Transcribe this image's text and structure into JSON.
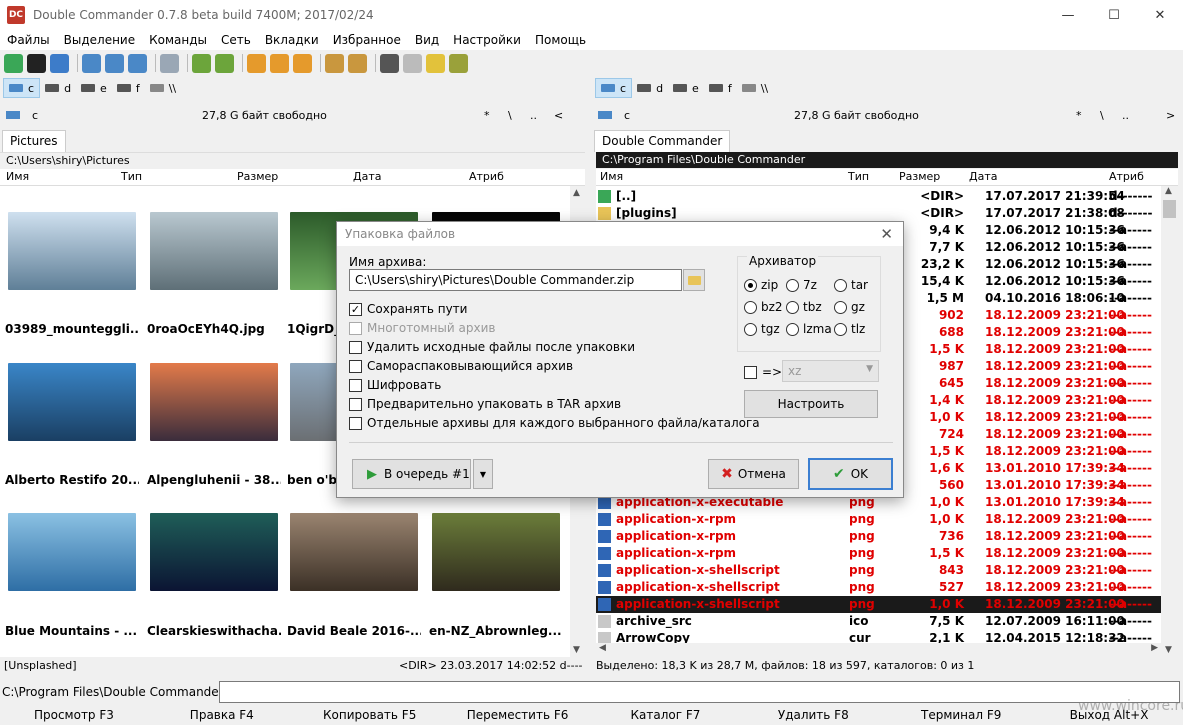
{
  "window": {
    "title": "Double Commander 0.7.8 beta build 7400M; 2017/02/24",
    "app_icon": "DC"
  },
  "menu": [
    "Файлы",
    "Выделение",
    "Команды",
    "Сеть",
    "Вкладки",
    "Избранное",
    "Вид",
    "Настройки",
    "Помощь"
  ],
  "drives": [
    {
      "label": "c"
    },
    {
      "label": "d"
    },
    {
      "label": "e"
    },
    {
      "label": "f"
    },
    {
      "label": "\\\\"
    }
  ],
  "left": {
    "drive": "c",
    "free": "27,8 G байт свободно",
    "nav": [
      "*",
      "\\",
      "..",
      "<"
    ],
    "tab": "Pictures",
    "path": "C:\\Users\\shiry\\Pictures",
    "columns": [
      "Имя",
      "Тип",
      "Размер",
      "Дата",
      "Атриб"
    ],
    "thumbs": [
      {
        "label": "03989_mounteggli...",
        "colors": [
          "#cfe0ef",
          "#5f7f97"
        ]
      },
      {
        "label": "0roaOcEYh4Q.jpg",
        "colors": [
          "#b9c8d0",
          "#5e6f77"
        ]
      },
      {
        "label": "1QigrD_P",
        "colors": [
          "#2c5a2a",
          "#6ba85c"
        ]
      },
      {
        "label": "",
        "colors": [
          "#050505",
          "#111111"
        ]
      },
      {
        "label": "Alberto Restifo  20...",
        "colors": [
          "#3a86c8",
          "#1a3f63"
        ]
      },
      {
        "label": "Alpengluhenii - 38...",
        "colors": [
          "#e37b4a",
          "#3a2d3c"
        ]
      },
      {
        "label": "ben o'bro",
        "colors": [
          "#8fa7bd",
          "#6b6f73"
        ]
      },
      {
        "label": "",
        "colors": [
          "#ffffff",
          "#ffffff"
        ]
      },
      {
        "label": "Blue Mountains - ...",
        "colors": [
          "#8bc1e3",
          "#2e6ea5"
        ]
      },
      {
        "label": "Clearskieswithacha...",
        "colors": [
          "#1f5e58",
          "#0b1433"
        ]
      },
      {
        "label": "David Beale  2016-...",
        "colors": [
          "#9a8470",
          "#3b3026"
        ]
      },
      {
        "label": "en-NZ_Abrownleg...",
        "colors": [
          "#6b7d3a",
          "#2f2a1d"
        ]
      }
    ],
    "status_left": "[Unsplashed]",
    "status_right": "<DIR>  23.03.2017 14:02:52   d-------"
  },
  "right": {
    "drive": "c",
    "free": "27,8 G байт свободно",
    "nav": [
      "*",
      "\\",
      "..",
      ">"
    ],
    "tab": "Double Commander",
    "path": "C:\\Program Files\\Double Commander",
    "columns": [
      "Имя",
      "Тип",
      "Размер",
      "Дата",
      "Атриб"
    ],
    "rows": [
      {
        "name": "[..]",
        "type": "",
        "size": "<DIR>",
        "date": "17.07.2017 21:39:54",
        "attr": "d-------",
        "red": false,
        "icon": "up-arrow-icon"
      },
      {
        "name": "[plugins]",
        "type": "",
        "size": "<DIR>",
        "date": "17.07.2017 21:38:08",
        "attr": "d-------",
        "red": false,
        "icon": "folder-icon"
      },
      {
        "name": "",
        "type": "",
        "size": "9,4 K",
        "date": "12.06.2012 10:15:36",
        "attr": "--a-----",
        "red": false,
        "icon": "file-icon"
      },
      {
        "name": "",
        "type": "",
        "size": "7,7 K",
        "date": "12.06.2012 10:15:36",
        "attr": "--a-----",
        "red": false,
        "icon": "file-icon"
      },
      {
        "name": "",
        "type": "",
        "size": "23,2 K",
        "date": "12.06.2012 10:15:36",
        "attr": "--a-----",
        "red": false,
        "icon": "file-icon"
      },
      {
        "name": "",
        "type": "",
        "size": "15,4 K",
        "date": "12.06.2012 10:15:36",
        "attr": "--a-----",
        "red": false,
        "icon": "file-icon"
      },
      {
        "name": "",
        "type": "",
        "size": "1,5 M",
        "date": "04.10.2016 18:06:10",
        "attr": "--a-----",
        "red": false,
        "icon": "file-icon"
      },
      {
        "name": "",
        "type": "",
        "size": "902",
        "date": "18.12.2009 23:21:00",
        "attr": "--a-----",
        "red": true,
        "icon": "file-icon"
      },
      {
        "name": "",
        "type": "",
        "size": "688",
        "date": "18.12.2009 23:21:00",
        "attr": "--a-----",
        "red": true,
        "icon": "file-icon"
      },
      {
        "name": "",
        "type": "",
        "size": "1,5 K",
        "date": "18.12.2009 23:21:00",
        "attr": "--a-----",
        "red": true,
        "icon": "file-icon"
      },
      {
        "name": "",
        "type": "",
        "size": "987",
        "date": "18.12.2009 23:21:00",
        "attr": "--a-----",
        "red": true,
        "icon": "file-icon"
      },
      {
        "name": "",
        "type": "",
        "size": "645",
        "date": "18.12.2009 23:21:00",
        "attr": "--a-----",
        "red": true,
        "icon": "file-icon"
      },
      {
        "name": "",
        "type": "",
        "size": "1,4 K",
        "date": "18.12.2009 23:21:00",
        "attr": "--a-----",
        "red": true,
        "icon": "file-icon"
      },
      {
        "name": "",
        "type": "",
        "size": "1,0 K",
        "date": "18.12.2009 23:21:00",
        "attr": "--a-----",
        "red": true,
        "icon": "file-icon"
      },
      {
        "name": "",
        "type": "",
        "size": "724",
        "date": "18.12.2009 23:21:00",
        "attr": "--a-----",
        "red": true,
        "icon": "file-icon"
      },
      {
        "name": "",
        "type": "",
        "size": "1,5 K",
        "date": "18.12.2009 23:21:00",
        "attr": "--a-----",
        "red": true,
        "icon": "file-icon"
      },
      {
        "name": "",
        "type": "",
        "size": "1,6 K",
        "date": "13.01.2010 17:39:34",
        "attr": "--a-----",
        "red": true,
        "icon": "file-icon"
      },
      {
        "name": "",
        "type": "",
        "size": "560",
        "date": "13.01.2010 17:39:34",
        "attr": "--a-----",
        "red": true,
        "icon": "file-icon"
      },
      {
        "name": "application-x-executable",
        "type": "png",
        "size": "1,0 K",
        "date": "13.01.2010 17:39:34",
        "attr": "--a-----",
        "red": true,
        "icon": "image-icon"
      },
      {
        "name": "application-x-rpm",
        "type": "png",
        "size": "1,0 K",
        "date": "18.12.2009 23:21:00",
        "attr": "--a-----",
        "red": true,
        "icon": "image-icon"
      },
      {
        "name": "application-x-rpm",
        "type": "png",
        "size": "736",
        "date": "18.12.2009 23:21:00",
        "attr": "--a-----",
        "red": true,
        "icon": "image-icon"
      },
      {
        "name": "application-x-rpm",
        "type": "png",
        "size": "1,5 K",
        "date": "18.12.2009 23:21:00",
        "attr": "--a-----",
        "red": true,
        "icon": "image-icon"
      },
      {
        "name": "application-x-shellscript",
        "type": "png",
        "size": "843",
        "date": "18.12.2009 23:21:00",
        "attr": "--a-----",
        "red": true,
        "icon": "image-icon"
      },
      {
        "name": "application-x-shellscript",
        "type": "png",
        "size": "527",
        "date": "18.12.2009 23:21:00",
        "attr": "--a-----",
        "red": true,
        "icon": "image-icon"
      },
      {
        "name": "application-x-shellscript",
        "type": "png",
        "size": "1,0 K",
        "date": "18.12.2009 23:21:00",
        "attr": "--a-----",
        "red": true,
        "icon": "image-icon",
        "selected": true
      },
      {
        "name": "archive_src",
        "type": "ico",
        "size": "7,5 K",
        "date": "12.07.2009 16:11:00",
        "attr": "--a-----",
        "red": false,
        "icon": "file-icon"
      },
      {
        "name": "ArrowCopy",
        "type": "cur",
        "size": "2,1 K",
        "date": "12.04.2015 12:18:32",
        "attr": "--a-----",
        "red": false,
        "icon": "file-icon"
      }
    ],
    "status": "Выделено: 18,3 K из 28,7 M, файлов: 18 из 597, каталогов: 0 из 1"
  },
  "command": {
    "prompt": "C:\\Program Files\\Double Commander\\>"
  },
  "fkeys": [
    "Просмотр F3",
    "Правка F4",
    "Копировать F5",
    "Переместить F6",
    "Каталог F7",
    "Удалить F8",
    "Терминал F9",
    "Выход Alt+X"
  ],
  "watermark": "www.wincore.ru",
  "dialog": {
    "title": "Упаковка файлов",
    "archive_label": "Имя архива:",
    "archive_value": "C:\\Users\\shiry\\Pictures\\Double Commander.zip",
    "options": [
      {
        "label": "Сохранять пути",
        "checked": true,
        "disabled": false
      },
      {
        "label": "Многотомный архив",
        "checked": false,
        "disabled": true
      },
      {
        "label": "Удалить исходные файлы после упаковки",
        "checked": false,
        "disabled": false
      },
      {
        "label": "Самораспаковывающийся архив",
        "checked": false,
        "disabled": false
      },
      {
        "label": "Шифровать",
        "checked": false,
        "disabled": false
      },
      {
        "label": "Предварительно упаковать в TAR архив",
        "checked": false,
        "disabled": false
      },
      {
        "label": "Отдельные архивы для каждого выбранного файла/каталога",
        "checked": false,
        "disabled": false
      }
    ],
    "archiver_label": "Архиватор",
    "formats": [
      {
        "label": "zip",
        "on": true
      },
      {
        "label": "7z",
        "on": false
      },
      {
        "label": "tar",
        "on": false
      },
      {
        "label": "bz2",
        "on": false
      },
      {
        "label": "tbz",
        "on": false
      },
      {
        "label": "gz",
        "on": false
      },
      {
        "label": "tgz",
        "on": false
      },
      {
        "label": "lzma",
        "on": false
      },
      {
        "label": "tlz",
        "on": false
      }
    ],
    "arrow_label": "=>",
    "combo_value": "xz",
    "configure": "Настроить",
    "queue": "В очередь #1",
    "cancel": "Отмена",
    "ok": "OK"
  }
}
